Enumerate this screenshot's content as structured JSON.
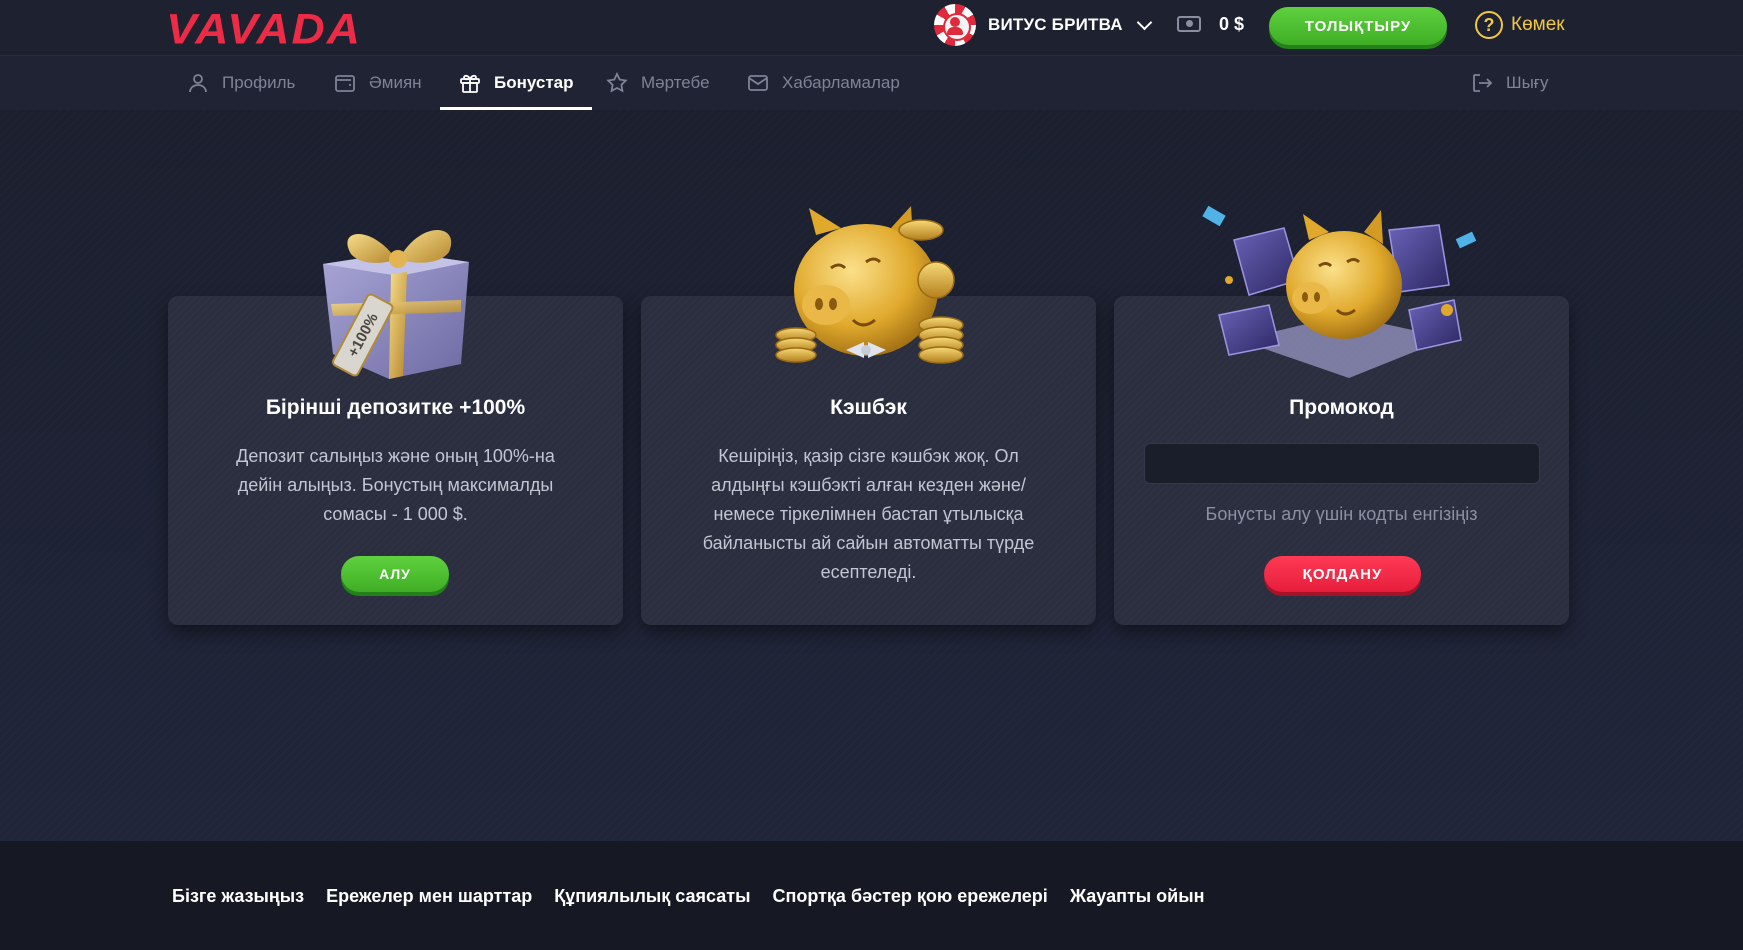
{
  "header": {
    "logo": "VAVADA",
    "username": "ВИТУС БРИТВА",
    "balance": "0 $",
    "topup_label": "ТОЛЫҚТЫРУ",
    "help_label": "Көмек",
    "help_icon_glyph": "?"
  },
  "nav": {
    "tabs": [
      {
        "label": "Профиль",
        "icon": "user-icon",
        "active": false
      },
      {
        "label": "Әмиян",
        "icon": "wallet-icon",
        "active": false
      },
      {
        "label": "Бонустар",
        "icon": "gift-icon",
        "active": true
      },
      {
        "label": "Мәртебе",
        "icon": "star-icon",
        "active": false
      },
      {
        "label": "Хабарламалар",
        "icon": "envelope-icon",
        "active": false
      }
    ],
    "logout_label": "Шығу"
  },
  "cards": [
    {
      "title": "Бірінші депозитке +100%",
      "text": "Депозит салыңыз және оның 100%-на дейін алыңыз. Бонустың максималды сомасы - 1 000 $.",
      "button": "АЛУ",
      "tag_text": "+100%"
    },
    {
      "title": "Кэшбэк",
      "text": "Кешіріңіз, қазір сізге кэшбэк жоқ. Ол алдыңғы кэшбэкті алған кезден және/немесе тіркелімнен бастап ұтылысқа байланысты ай сайын автоматты түрде есептеледі."
    },
    {
      "title": "Промокод",
      "input_value": "",
      "hint": "Бонусты алу үшін кодты енгізіңіз",
      "button": "ҚОЛДАНУ"
    }
  ],
  "footer": {
    "links": [
      "Бізге жазыңыз",
      "Ережелер мен шарттар",
      "Құпиялылық саясаты",
      "Спортқа бәстер қою ережелері",
      "Жауапты ойын"
    ]
  },
  "colors": {
    "brand": "#ee2b46",
    "accent_green": "#4cc12f",
    "accent_red": "#f0263f",
    "help_yellow": "#f2c744",
    "background": "#1c2030"
  }
}
